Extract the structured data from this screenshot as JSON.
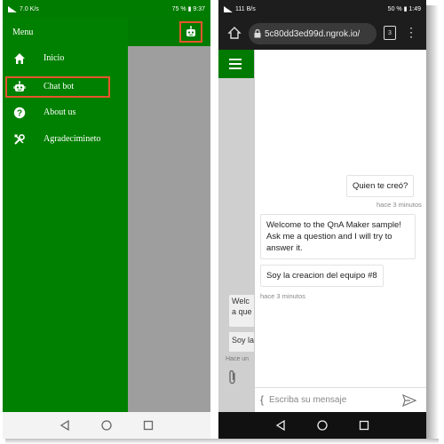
{
  "left_phone": {
    "status": {
      "left": "7.0 K/s",
      "right": "75 % ▮ 9:37"
    },
    "drawer": {
      "title": "Menu",
      "items": [
        {
          "label": "Inicio",
          "icon": "home-icon"
        },
        {
          "label": "Chat bot",
          "icon": "robot-icon",
          "selected": true
        },
        {
          "label": "About us",
          "icon": "help-circle-icon"
        },
        {
          "label": "Agradecimineto",
          "icon": "tools-icon"
        }
      ]
    }
  },
  "right_phone": {
    "status": {
      "left": "111 B/s",
      "right": "50 % ▮ 1:49"
    },
    "browser": {
      "url": "5c80dd3ed99d.ngrok.io/",
      "tab_count": "3"
    },
    "chat": {
      "messages": [
        {
          "from": "user",
          "text": "Quien te creó?",
          "time": "hace 3 minutos"
        },
        {
          "from": "bot",
          "text": "Welcome to the QnA Maker sample! Ask me a question and I will try to answer it.",
          "time": ""
        },
        {
          "from": "bot",
          "text": "Soy la creacion del equipo #8",
          "time": "hace 3 minutos"
        }
      ],
      "input_placeholder": "Escriba su mensaje"
    },
    "behind": {
      "text1": "Welc",
      "text2": "a que",
      "text3": "Soy la",
      "time": "Hace un"
    }
  },
  "colors": {
    "green": "#008000",
    "dark_green": "#007a00",
    "highlight": "#e8542c"
  }
}
